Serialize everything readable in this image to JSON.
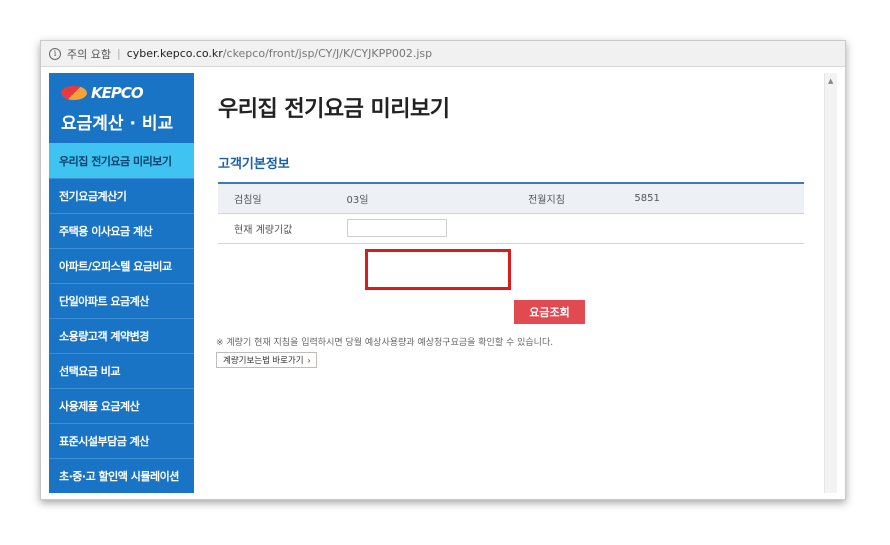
{
  "addressbar": {
    "warning": "주의 요함",
    "separator": "|",
    "host": "cyber.kepco.co.kr",
    "path": "/ckepco/front/jsp/CY/J/K/CYJKPP002.jsp"
  },
  "sidebar": {
    "logo_text": "KEPCO",
    "title": "요금계산 · 비교",
    "items": [
      {
        "label": "우리집 전기요금 미리보기",
        "active": true
      },
      {
        "label": "전기요금계산기"
      },
      {
        "label": "주택용 이사요금 계산"
      },
      {
        "label": "아파트/오피스텔 요금비교"
      },
      {
        "label": "단일아파트 요금계산"
      },
      {
        "label": "소용량고객 계약변경"
      },
      {
        "label": "선택요금 비교"
      },
      {
        "label": "사용제품 요금계산"
      },
      {
        "label": "표준시설부담금 계산"
      },
      {
        "label": "초·중·고 할인액 시뮬레이션"
      }
    ]
  },
  "main": {
    "page_title": "우리집 전기요금 미리보기",
    "section_title": "고객기본정보",
    "table": {
      "row1": {
        "label1": "검침일",
        "value1": "03일",
        "label2": "전월지침",
        "value2": "5851"
      },
      "row2": {
        "label": "현재 계량기값",
        "input_value": ""
      }
    },
    "query_button": "요금조회",
    "notice": "※ 계량기 현재 지침을 입력하시면 당월 예상사용량과 예상청구요금을 확인할 수 있습니다.",
    "guide_button": "계량기보는법 바로가기",
    "guide_arrow": "›"
  },
  "colors": {
    "sidebar_bg": "#1a74c5",
    "active_item": "#3fc3f0",
    "query_button": "#e24a52",
    "highlight": "#d81d1d",
    "section_title": "#1a5fa8"
  }
}
